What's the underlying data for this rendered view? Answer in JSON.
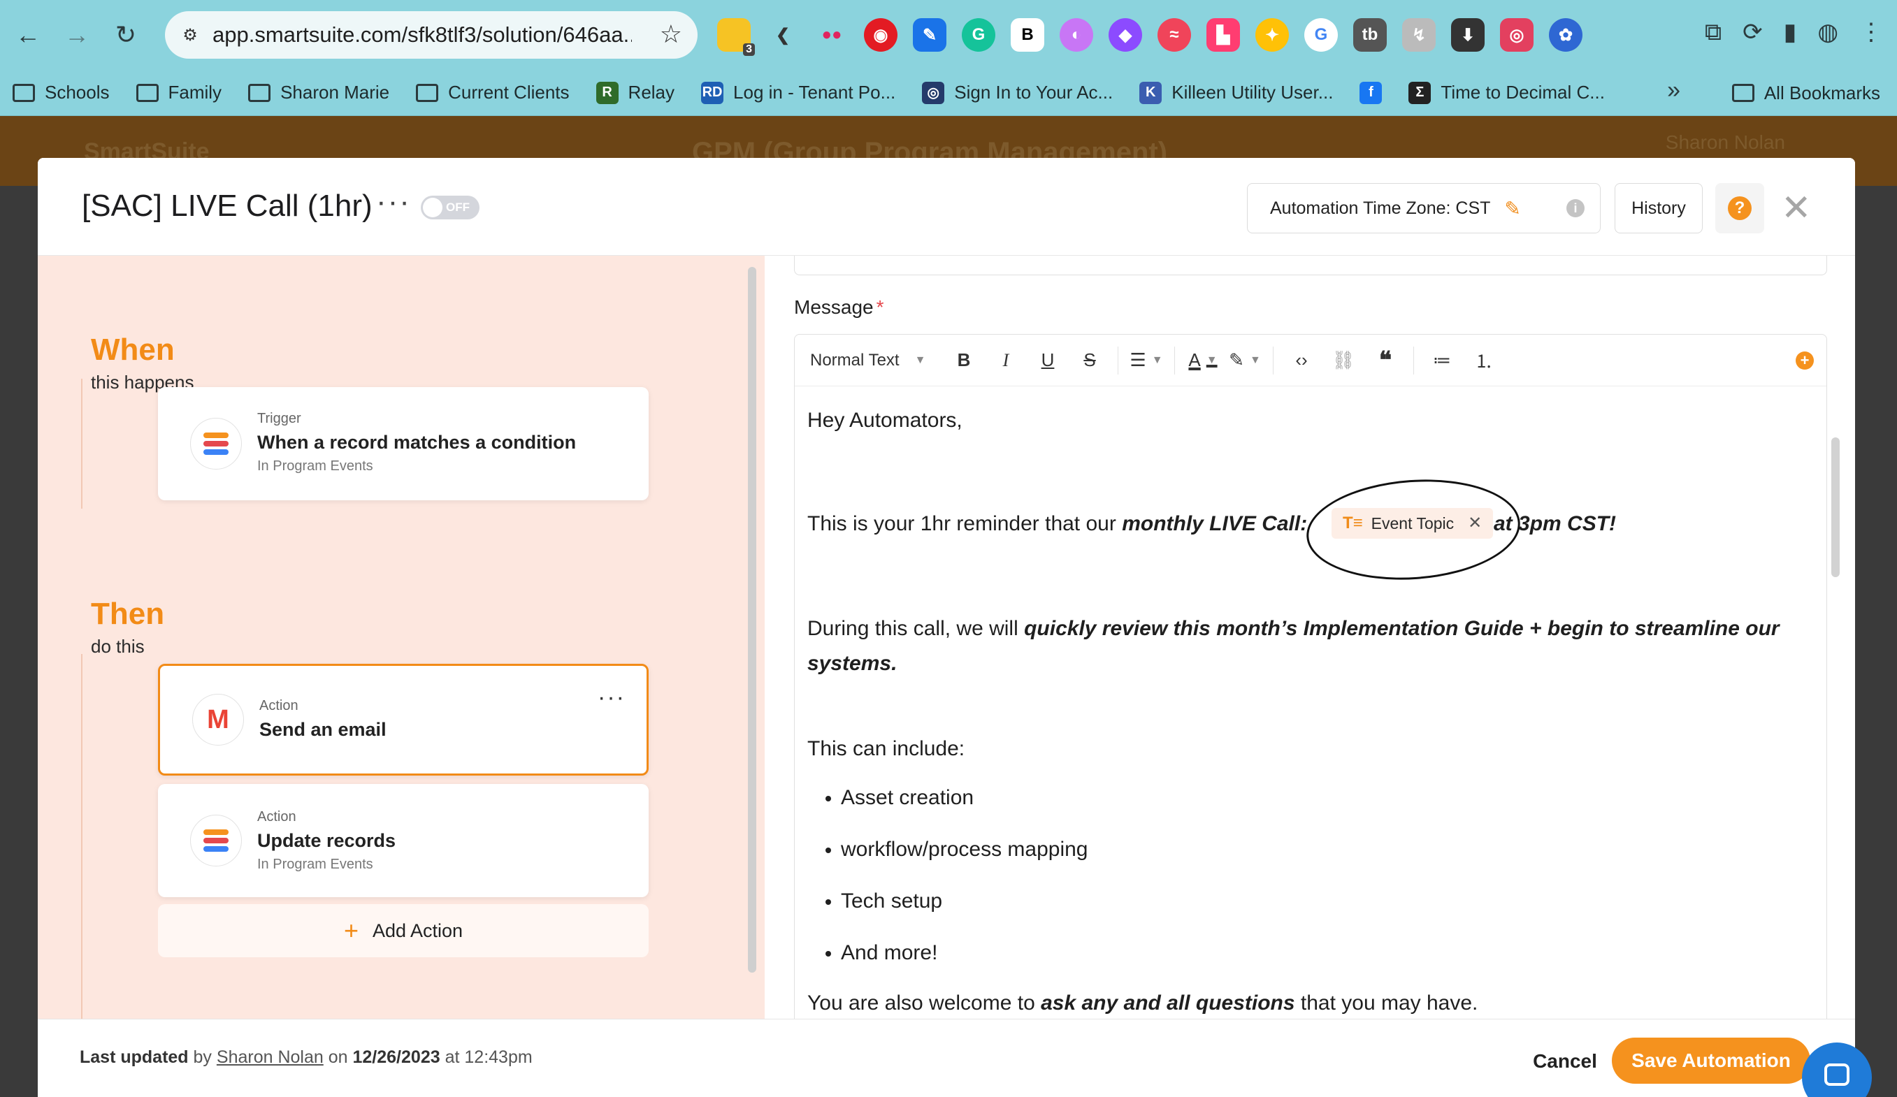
{
  "browser": {
    "url": "app.smartsuite.com/sfk8tlf3/solution/646aa...",
    "ext_badge": "3",
    "bookmarks": [
      {
        "label": "Schools",
        "type": "folder"
      },
      {
        "label": "Family",
        "type": "folder"
      },
      {
        "label": "Sharon Marie",
        "type": "folder"
      },
      {
        "label": "Current Clients",
        "type": "folder"
      },
      {
        "label": "Relay",
        "type": "site",
        "color": "#2f6b2a",
        "glyph": "R"
      },
      {
        "label": "Log in - Tenant Po...",
        "type": "site",
        "color": "#1e5fb4",
        "glyph": "RD"
      },
      {
        "label": "Sign In to Your Ac...",
        "type": "site",
        "color": "#243a6a",
        "glyph": "◎"
      },
      {
        "label": "Killeen Utility User...",
        "type": "site",
        "color": "#3a5db0",
        "glyph": "K"
      },
      {
        "label": "",
        "type": "site",
        "color": "#1877f2",
        "glyph": "f"
      },
      {
        "label": "Time to Decimal C...",
        "type": "site",
        "color": "#222222",
        "glyph": "Σ"
      }
    ],
    "all_bookmarks": "All Bookmarks"
  },
  "background_app": {
    "brand": "SmartSuite",
    "title": "GPM (Group Program Management)",
    "user": "Sharon Nolan"
  },
  "modal": {
    "title": "[SAC] LIVE Call (1hr)",
    "toggle_label": "OFF",
    "timezone_label": "Automation Time Zone: CST",
    "history_label": "History",
    "help_glyph": "?",
    "close_glyph": "✕"
  },
  "flow": {
    "when_title": "When",
    "when_sub": "this happens",
    "then_title": "Then",
    "then_sub": "do this",
    "trigger": {
      "kind": "Trigger",
      "name": "When a record matches a condition",
      "where": "In Program Events"
    },
    "actions": [
      {
        "kind": "Action",
        "name": "Send an email",
        "where": ""
      },
      {
        "kind": "Action",
        "name": "Update records",
        "where": "In Program Events"
      }
    ],
    "add_action": "Add Action"
  },
  "editor": {
    "label": "Message",
    "required": "*",
    "style_select": "Normal Text",
    "greeting": "Hey Automators,",
    "reminder_pre": "This is your 1hr reminder that our ",
    "reminder_bold": "monthly LIVE Call:",
    "chip_label": "Event Topic",
    "reminder_post": "at 3pm CST!",
    "during_pre": "During this call, we will ",
    "during_bold": "quickly review this month’s Implementation Guide + begin to streamline our systems.",
    "include_intro": "This can include:",
    "bullets": [
      "Asset creation",
      "workflow/process mapping",
      "Tech setup",
      "And more!"
    ],
    "welcome_pre": "You are also welcome to ",
    "welcome_bold": "ask any and all questions",
    "welcome_post": " that you may have."
  },
  "footer": {
    "last_updated": "Last updated",
    "by": "by",
    "user": "Sharon Nolan",
    "on": "on",
    "date": "12/26/2023",
    "at": "at",
    "time": "12:43pm",
    "cancel": "Cancel",
    "save": "Save Automation"
  },
  "colors": {
    "accent": "#f28b17",
    "left_pane_bg": "#fde7df",
    "chrome_bg": "#8bd3dd"
  }
}
